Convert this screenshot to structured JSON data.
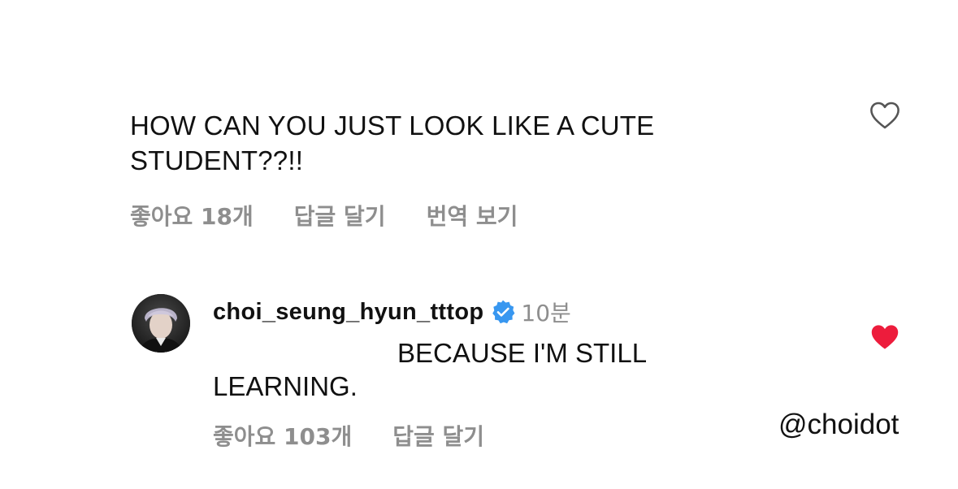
{
  "comment": {
    "text": "HOW CAN YOU JUST LOOK LIKE A CUTE\nSTUDENT??!!",
    "likes_label": "좋아요 18개",
    "reply_label": "답글 달기",
    "translate_label": "번역 보기",
    "like_icon": "heart-outline-icon"
  },
  "reply": {
    "username": "choi_seung_hyun_tttop",
    "verified_icon": "verified-badge-icon",
    "time": "10분",
    "text_line1": "BECAUSE I'M STILL",
    "text_line2": "LEARNING.",
    "likes_label": "좋아요 103개",
    "reply_label": "답글 달기",
    "like_icon": "heart-filled-icon"
  },
  "watermark": "@choidot",
  "colors": {
    "text": "#111111",
    "meta": "#8e8e8e",
    "like_red": "#ed1c3c",
    "verified_blue": "#3897f0"
  }
}
